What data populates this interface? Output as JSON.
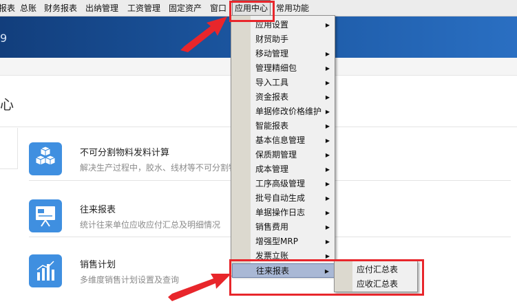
{
  "menubar": {
    "items": [
      "报表",
      "总账",
      "财务报表",
      "出纳管理",
      "工资管理",
      "固定资产",
      "窗口",
      "应用中心",
      "常用功能"
    ],
    "active_index": 7
  },
  "banner": {
    "version_fragment": "9"
  },
  "page": {
    "title": "心"
  },
  "apps": [
    {
      "name": "不可分割物料发料计算",
      "desc": "解决生产过程中，胶水、线材等不可分割物",
      "icon": "cubes-icon"
    },
    {
      "name": "往来报表",
      "desc": "统计往来单位应收应付汇总及明细情况",
      "icon": "presentation-icon"
    },
    {
      "name": "销售计划",
      "desc": "多维度销售计划设置及查询",
      "icon": "bar-chart-icon"
    }
  ],
  "dropdown": {
    "items": [
      {
        "label": "应用设置",
        "submenu": true
      },
      {
        "label": "财贸助手",
        "submenu": false
      },
      {
        "label": "移动管理",
        "submenu": true
      },
      {
        "label": "管理精细包",
        "submenu": true
      },
      {
        "label": "导入工具",
        "submenu": true
      },
      {
        "label": "资金报表",
        "submenu": true
      },
      {
        "label": "单据修改价格维护",
        "submenu": true
      },
      {
        "label": "智能报表",
        "submenu": true
      },
      {
        "label": "基本信息管理",
        "submenu": true
      },
      {
        "label": "保质期管理",
        "submenu": true
      },
      {
        "label": "成本管理",
        "submenu": true
      },
      {
        "label": "工序高级管理",
        "submenu": true
      },
      {
        "label": "批号自动生成",
        "submenu": true
      },
      {
        "label": "单据操作日志",
        "submenu": true
      },
      {
        "label": "销售费用",
        "submenu": true
      },
      {
        "label": "增强型MRP",
        "submenu": true
      },
      {
        "label": "发票立账",
        "submenu": true
      },
      {
        "label": "往来报表",
        "submenu": true
      }
    ],
    "highlighted_index": 17
  },
  "submenu": {
    "items": [
      "应付汇总表",
      "应收汇总表"
    ]
  },
  "colors": {
    "annotation": "#e8262b",
    "highlight": "#a9b8d5",
    "banner": "#1d5aa6"
  }
}
